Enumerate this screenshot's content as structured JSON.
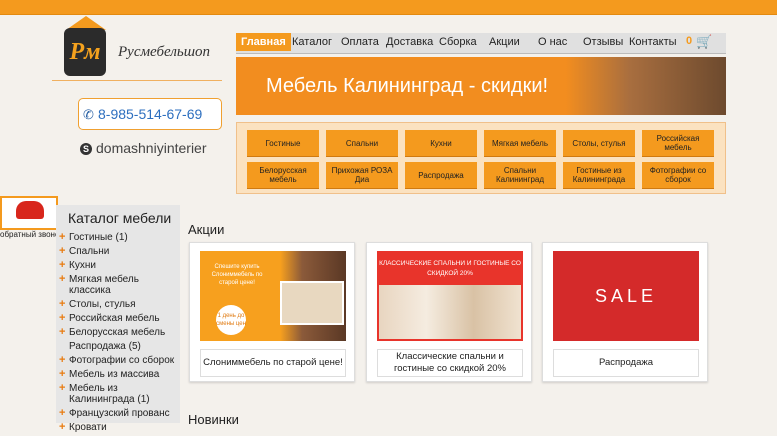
{
  "logo": {
    "mark": "Рм",
    "name": "Русмебельшоп"
  },
  "contact": {
    "phone": "8-985-514-67-69",
    "skype": "domashniyinterier"
  },
  "nav": [
    {
      "label": "Главная",
      "active": true
    },
    {
      "label": "Каталог",
      "active": false
    },
    {
      "label": "Оплата",
      "active": false
    },
    {
      "label": "Доставка",
      "active": false
    },
    {
      "label": "Сборка",
      "active": false
    },
    {
      "label": "Акции",
      "active": false
    },
    {
      "label": "О нас",
      "active": false
    },
    {
      "label": "Отзывы",
      "active": false
    },
    {
      "label": "Контакты",
      "active": false
    }
  ],
  "cart": {
    "count": "0"
  },
  "banner": {
    "text": "Мебель Калининград - скидки!"
  },
  "categories": [
    "Гостиные",
    "Спальни",
    "Кухни",
    "Мягкая мебель",
    "Столы, стулья",
    "Российская мебель",
    "Белорусская мебель",
    "Прихожая РОЗА Диа",
    "Распродажа",
    "Спальни Калининград",
    "Гостиные из Калининграда",
    "Фотографии со сборок"
  ],
  "callback": {
    "label": "обратный звонок"
  },
  "sidebar": {
    "title": "Каталог мебели",
    "items": [
      {
        "label": "Гостиные (1)",
        "plus": true
      },
      {
        "label": "Спальни",
        "plus": true
      },
      {
        "label": "Кухни",
        "plus": true
      },
      {
        "label": "Мягкая мебель классика",
        "plus": true
      },
      {
        "label": "Столы, стулья",
        "plus": true
      },
      {
        "label": "Российская мебель",
        "plus": true
      },
      {
        "label": "Белорусская мебель",
        "plus": true
      },
      {
        "label": "Распродажа (5)",
        "plus": false
      },
      {
        "label": "Фотографии со сборок",
        "plus": true
      },
      {
        "label": "Мебель из массива",
        "plus": true
      },
      {
        "label": "Мебель из Калининграда (1)",
        "plus": true
      },
      {
        "label": "Французский прованс",
        "plus": true
      },
      {
        "label": "Кровати",
        "plus": true
      }
    ]
  },
  "promos": {
    "title": "Акции",
    "items": [
      {
        "caption": "Слониммебель по старой цене!",
        "img_text": "Спешите купить Слониммебель по старой цене!",
        "img_badge": "1 день до смены цен"
      },
      {
        "caption": "Классические спальни и гостиные со скидкой 20%",
        "img_text": "КЛАССИЧЕСКИЕ СПАЛЬНИ И ГОСТИНЫЕ СО СКИДКОЙ 20%"
      },
      {
        "caption": "Распродажа",
        "img_text": "SALE"
      }
    ]
  },
  "novelties": {
    "title": "Новинки"
  }
}
